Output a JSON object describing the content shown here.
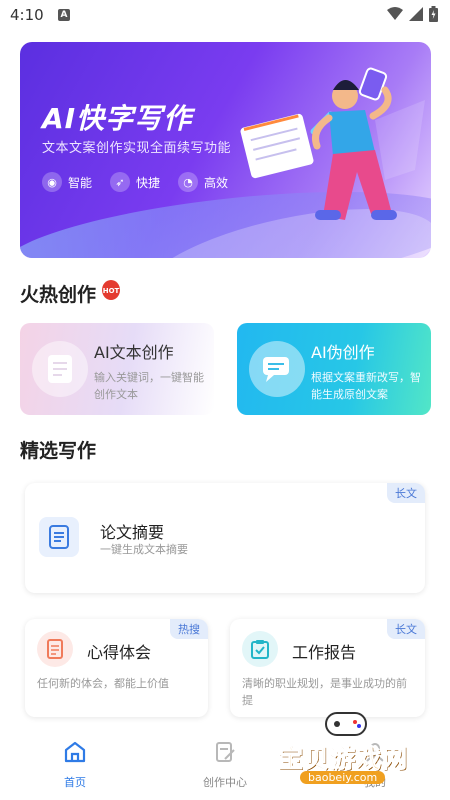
{
  "status_bar": {
    "time": "4:10",
    "a_badge": "A"
  },
  "banner": {
    "title": "AI快字写作",
    "subtitle": "文本文案创作实现全面续写功能",
    "features": [
      {
        "icon": "robot-icon",
        "label": "智能"
      },
      {
        "icon": "rocket-icon",
        "label": "快捷"
      },
      {
        "icon": "speed-icon",
        "label": "高效"
      }
    ]
  },
  "hot_section": {
    "title": "火热创作",
    "badge": "HOT",
    "cards": [
      {
        "title": "AI文本创作",
        "desc": "输入关键词，一键智能创作文本"
      },
      {
        "title": "AI伪创作",
        "desc": "根据文案重新改写，智能生成原创文案"
      }
    ]
  },
  "select_section": {
    "title": "精选写作",
    "cards": [
      {
        "title": "论文摘要",
        "desc": "一键生成文本摘要",
        "tag": "长文"
      },
      {
        "title": "心得体会",
        "desc": "任何新的体会，都能上价值",
        "tag": "热搜"
      },
      {
        "title": "工作报告",
        "desc": "清晰的职业规划，是事业成功的前提",
        "tag": "长文"
      }
    ]
  },
  "bottom_nav": {
    "items": [
      {
        "label": "首页",
        "icon": "home-icon"
      },
      {
        "label": "创作中心",
        "icon": "edit-doc-icon"
      },
      {
        "label": "我的",
        "icon": "user-icon"
      }
    ]
  },
  "watermark": {
    "text": "宝贝游戏网",
    "url": "baobeiy.com"
  },
  "colors": {
    "accent": "#2f7be6",
    "banner_purple": "#6a35e8",
    "tag_bg": "#e3ecfb"
  }
}
